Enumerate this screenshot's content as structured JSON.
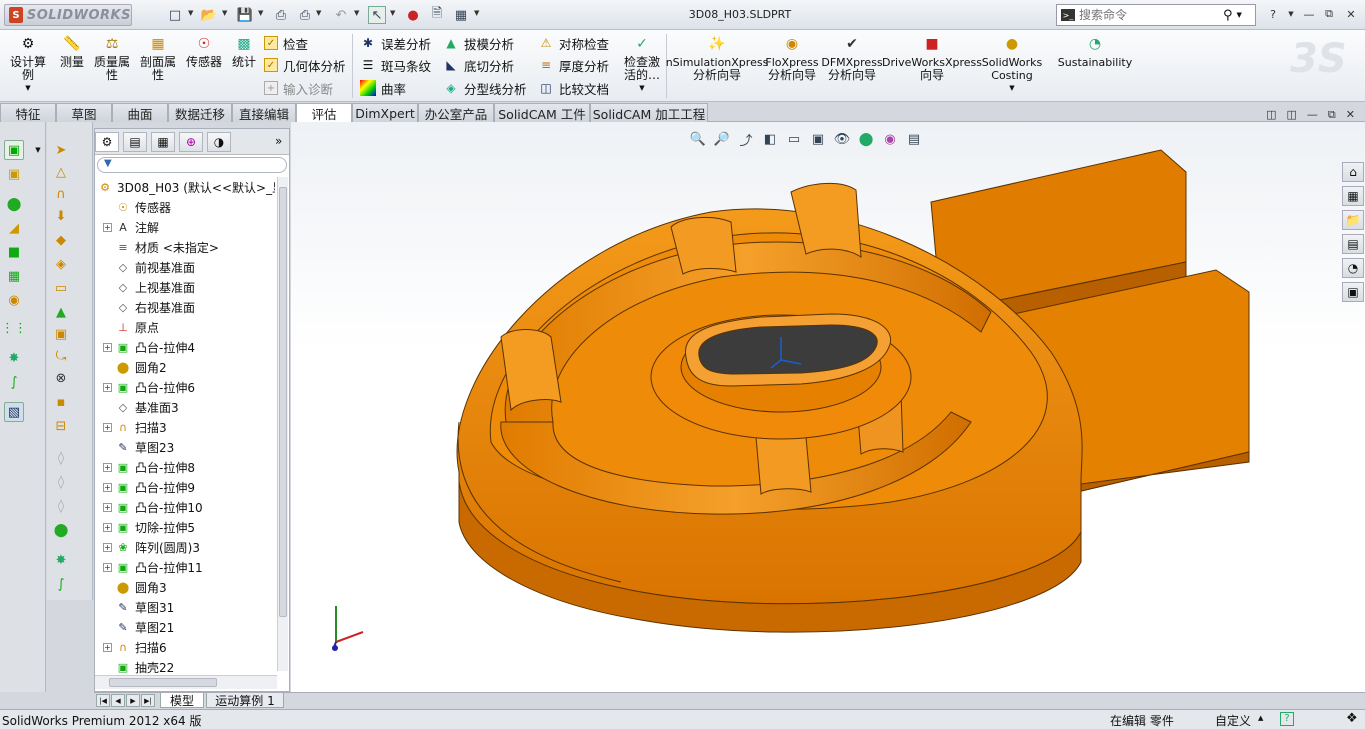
{
  "app": {
    "logo_text": "SOLIDWORKS",
    "document_title": "3D08_H03.SLDPRT"
  },
  "search": {
    "placeholder": "搜索命令"
  },
  "ribbon": {
    "big_buttons": [
      {
        "label": "设计算例",
        "icon": "design-study-icon"
      },
      {
        "label": "测量",
        "icon": "measure-icon"
      },
      {
        "label": "质量属性",
        "icon": "mass-properties-icon"
      },
      {
        "label": "剖面属性",
        "icon": "section-properties-icon"
      },
      {
        "label": "传感器",
        "icon": "sensor-icon"
      },
      {
        "label": "统计",
        "icon": "statistics-icon"
      }
    ],
    "check_group": [
      {
        "label": "检查",
        "icon": "check-icon"
      },
      {
        "label": "几何体分析",
        "icon": "geometry-analysis-icon"
      },
      {
        "label": "输入诊断",
        "icon": "import-diagnostics-icon"
      }
    ],
    "analysis_group_1": [
      {
        "label": "误差分析",
        "icon": "deviation-analysis-icon"
      },
      {
        "label": "斑马条纹",
        "icon": "zebra-stripes-icon"
      },
      {
        "label": "曲率",
        "icon": "curvature-icon"
      }
    ],
    "analysis_group_2": [
      {
        "label": "拔模分析",
        "icon": "draft-analysis-icon"
      },
      {
        "label": "底切分析",
        "icon": "undercut-analysis-icon"
      },
      {
        "label": "分型线分析",
        "icon": "parting-line-icon"
      }
    ],
    "analysis_group_3": [
      {
        "label": "对称检查",
        "icon": "symmetry-check-icon"
      },
      {
        "label": "厚度分析",
        "icon": "thickness-analysis-icon"
      },
      {
        "label": "比较文档",
        "icon": "compare-documents-icon"
      }
    ],
    "check_active": "检查激活的…",
    "xpress": [
      {
        "label": "nSimulationXpress分析向导",
        "line1": "nSimulationXpress",
        "line2": "分析向导"
      },
      {
        "label": "FloXpress分析向导",
        "line1": "FloXpress",
        "line2": "分析向导"
      },
      {
        "label": "DFMXpress分析向导",
        "line1": "DFMXpress",
        "line2": "分析向导"
      },
      {
        "label": "DriveWorksXpress向导",
        "line1": "DriveWorksXpress",
        "line2": "向导"
      },
      {
        "label": "SolidWorks Costing",
        "line1": "SolidWorks",
        "line2": "Costing"
      },
      {
        "label": "Sustainability",
        "line1": "Sustainability",
        "line2": ""
      }
    ]
  },
  "tabs": [
    "特征",
    "草图",
    "曲面",
    "数据迁移",
    "直接编辑",
    "评估",
    "DimXpert",
    "办公室产品",
    "SolidCAM 工件",
    "SolidCAM 加工工程"
  ],
  "active_tab": "评估",
  "feature_tree": {
    "root": "3D08_H03 (默认<<默认>_显",
    "filter_icon": "filter-icon",
    "items": [
      {
        "label": "传感器",
        "icon": "sensor-icon",
        "expandable": false
      },
      {
        "label": "注解",
        "icon": "annotations-icon",
        "expandable": true
      },
      {
        "label": "材质 <未指定>",
        "icon": "material-icon",
        "expandable": false
      },
      {
        "label": "前视基准面",
        "icon": "plane-icon",
        "expandable": false
      },
      {
        "label": "上视基准面",
        "icon": "plane-icon",
        "expandable": false
      },
      {
        "label": "右视基准面",
        "icon": "plane-icon",
        "expandable": false
      },
      {
        "label": "原点",
        "icon": "origin-icon",
        "expandable": false
      },
      {
        "label": "凸台-拉伸4",
        "icon": "boss-extrude-icon",
        "expandable": true
      },
      {
        "label": "圆角2",
        "icon": "fillet-icon",
        "expandable": false
      },
      {
        "label": "凸台-拉伸6",
        "icon": "boss-extrude-icon",
        "expandable": true
      },
      {
        "label": "基准面3",
        "icon": "plane-icon",
        "expandable": false
      },
      {
        "label": "扫描3",
        "icon": "sweep-icon",
        "expandable": true
      },
      {
        "label": "草图23",
        "icon": "sketch-icon",
        "expandable": false
      },
      {
        "label": "凸台-拉伸8",
        "icon": "boss-extrude-icon",
        "expandable": true
      },
      {
        "label": "凸台-拉伸9",
        "icon": "boss-extrude-icon",
        "expandable": true
      },
      {
        "label": "凸台-拉伸10",
        "icon": "boss-extrude-icon",
        "expandable": true
      },
      {
        "label": "切除-拉伸5",
        "icon": "cut-extrude-icon",
        "expandable": true
      },
      {
        "label": "阵列(圆周)3",
        "icon": "circular-pattern-icon",
        "expandable": true
      },
      {
        "label": "凸台-拉伸11",
        "icon": "boss-extrude-icon",
        "expandable": true
      },
      {
        "label": "圆角3",
        "icon": "fillet-icon",
        "expandable": false
      },
      {
        "label": "草图31",
        "icon": "sketch-icon",
        "expandable": false
      },
      {
        "label": "草图21",
        "icon": "sketch-icon",
        "expandable": false
      },
      {
        "label": "扫描6",
        "icon": "sweep-icon",
        "expandable": true
      },
      {
        "label": "抽壳22",
        "icon": "shell-icon",
        "expandable": false
      }
    ]
  },
  "bottom_tabs": [
    "模型",
    "运动算例 1"
  ],
  "status": {
    "left": "SolidWorks Premium 2012 x64 版",
    "editing": "在编辑 零件",
    "units": "自定义",
    "help": "?"
  },
  "colors": {
    "part_orange": "#f08a00",
    "part_edge": "#6a3a00",
    "accent_blue": "#2a5ea8"
  }
}
